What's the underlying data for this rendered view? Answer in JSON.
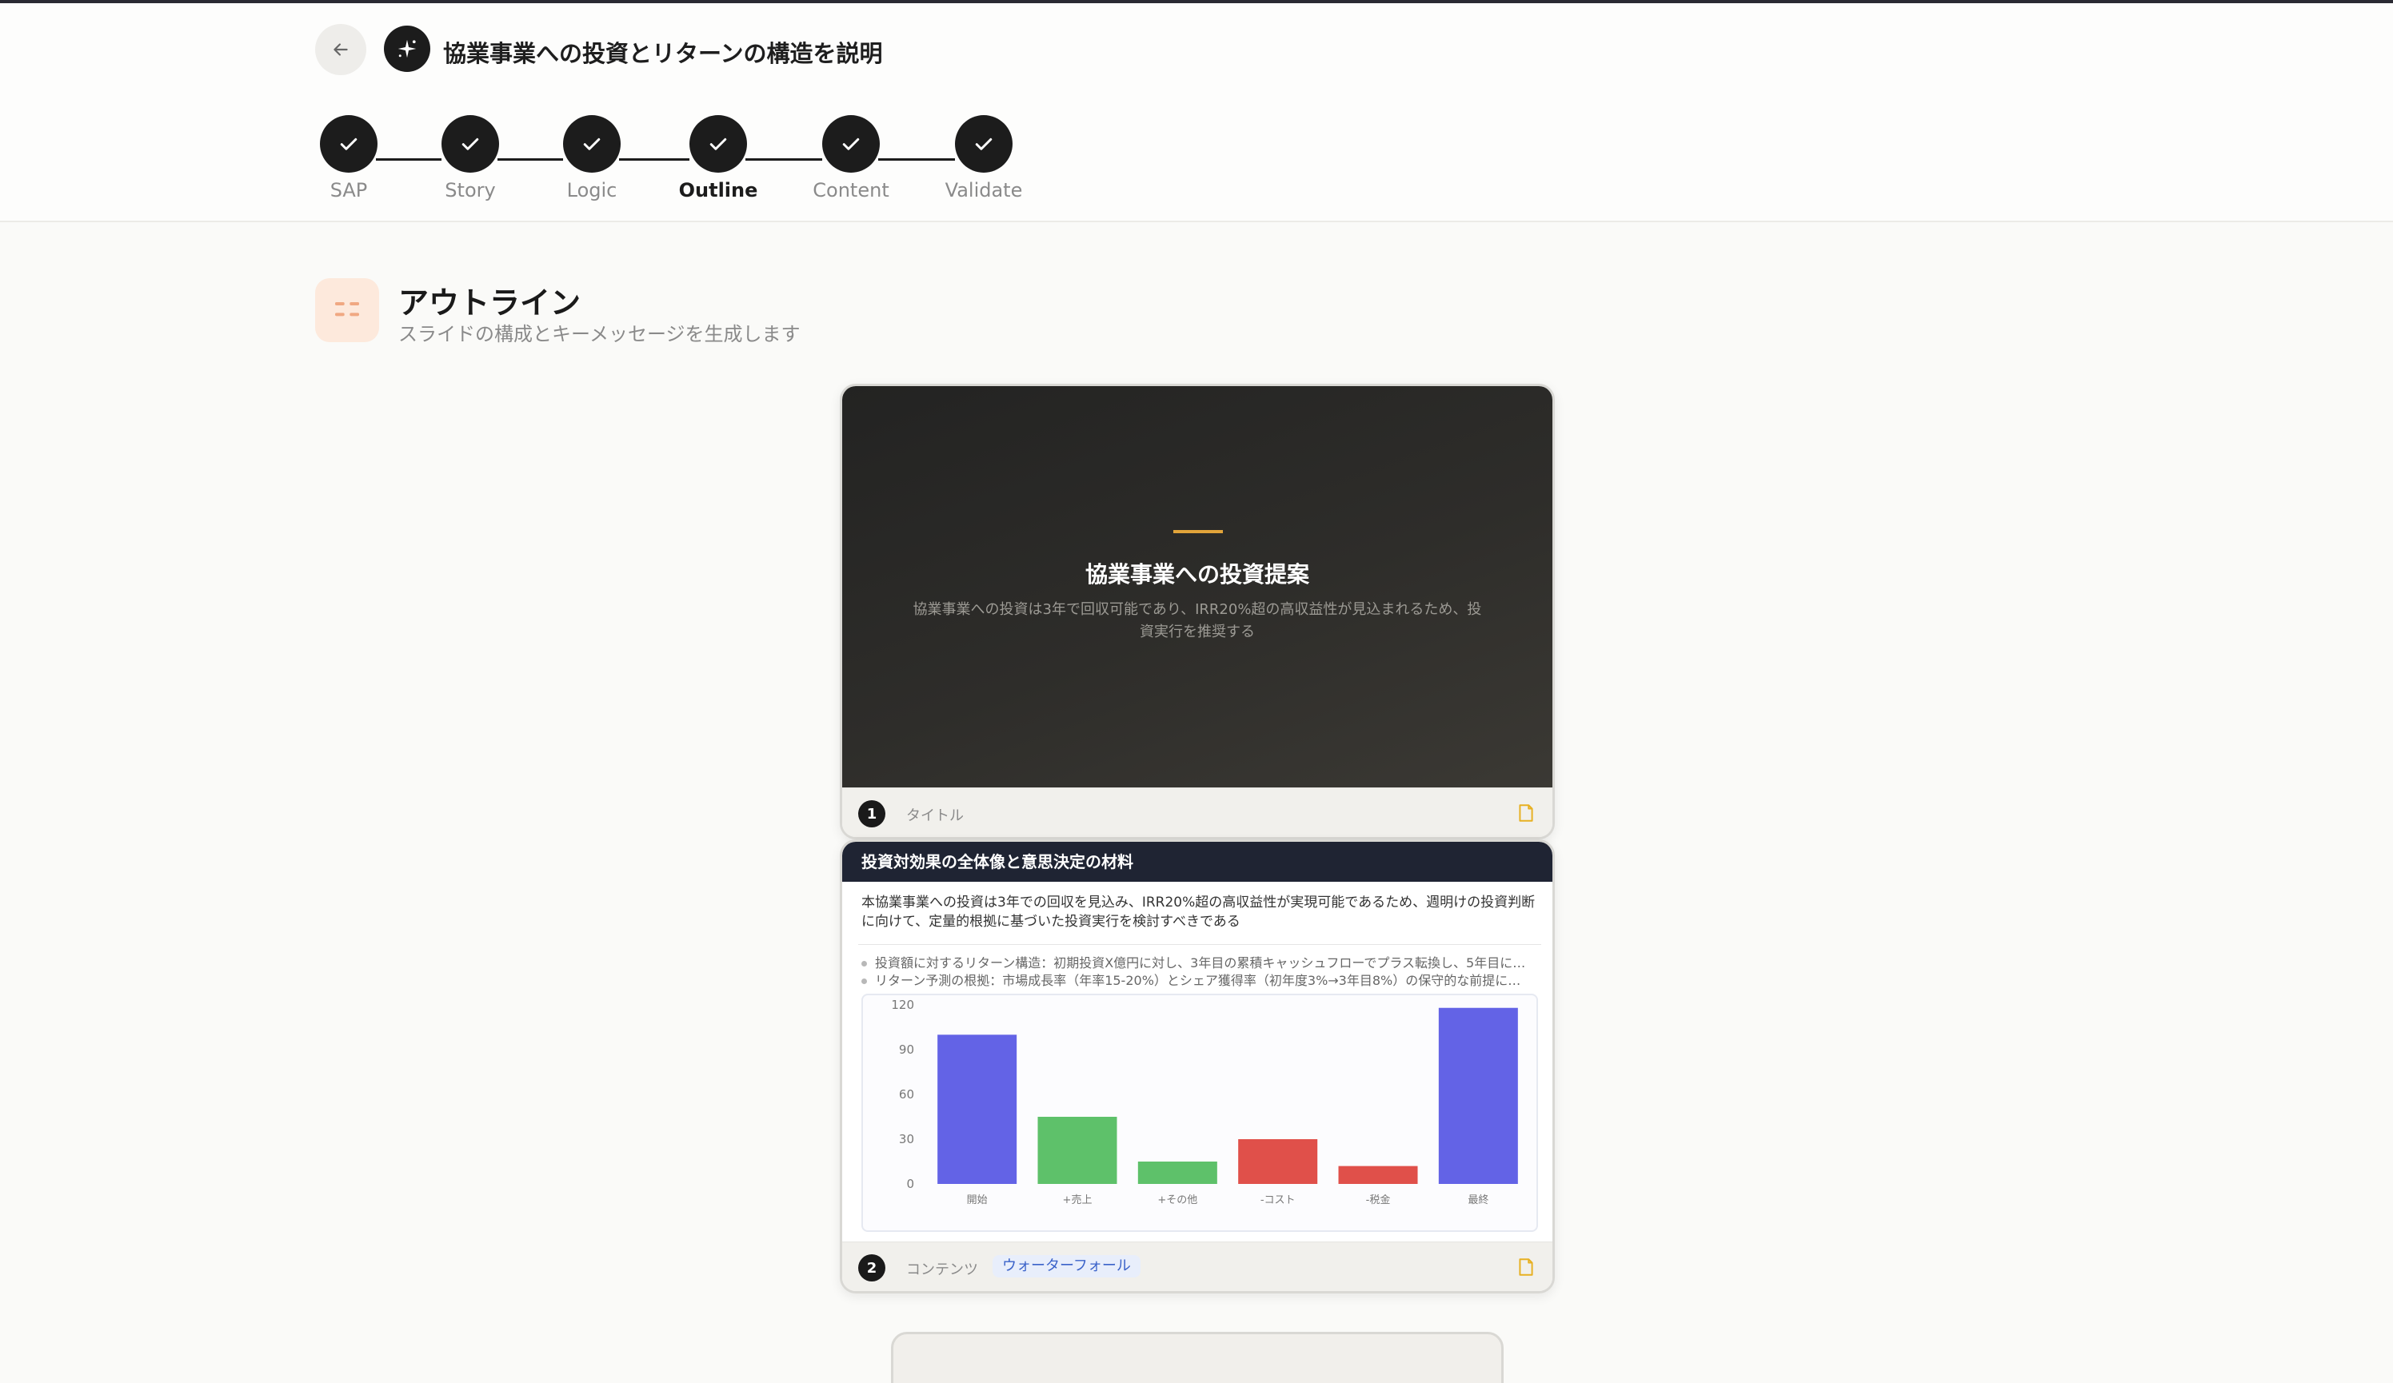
{
  "header": {
    "title": "協業事業への投資とリターンの構造を説明"
  },
  "steps": [
    {
      "label": "SAP"
    },
    {
      "label": "Story"
    },
    {
      "label": "Logic"
    },
    {
      "label": "Outline"
    },
    {
      "label": "Content"
    },
    {
      "label": "Validate"
    }
  ],
  "section": {
    "title": "アウトライン",
    "subtitle": "スライドの構成とキーメッセージを生成します"
  },
  "slides": [
    {
      "number": "1",
      "title": "協業事業への投資提案",
      "subtitle": "協業事業への投資は3年で回収可能であり、IRR20%超の高収益性が見込まれるため、投資実行を推奨する",
      "type": "タイトル"
    },
    {
      "number": "2",
      "title": "投資対効果の全体像と意思決定の材料",
      "key_message": "本協業事業への投資は3年での回収を見込み、IRR20%超の高収益性が実現可能であるため、週明けの投資判断に向けて、定量的根拠に基づいた投資実行を検討すべきである",
      "bullets": [
        "投資額に対するリターン構造：初期投資X億円に対し、3年目の累積キャッシュフローでプラス転換し、5年目に…",
        "リターン予測の根拠：市場成長率（年率15-20%）とシェア獲得率（初年度3%→3年目8%）の保守的な前提に…"
      ],
      "type": "コンテンツ",
      "tag": "ウォーターフォール"
    }
  ],
  "chart_data": {
    "type": "bar",
    "categories": [
      "開始",
      "+売上",
      "+その他",
      "-コスト",
      "-税金",
      "最終"
    ],
    "values": [
      100,
      45,
      15,
      30,
      12,
      118
    ],
    "y_ticks": [
      "0",
      "30",
      "60",
      "90",
      "120"
    ],
    "ylim": [
      0,
      120
    ],
    "colors": {
      "total": "#6363e6",
      "increase": "#5ec16a",
      "decrease": "#e0504a"
    },
    "bar_kinds": [
      "total",
      "increase",
      "increase",
      "decrease",
      "decrease",
      "total"
    ]
  }
}
